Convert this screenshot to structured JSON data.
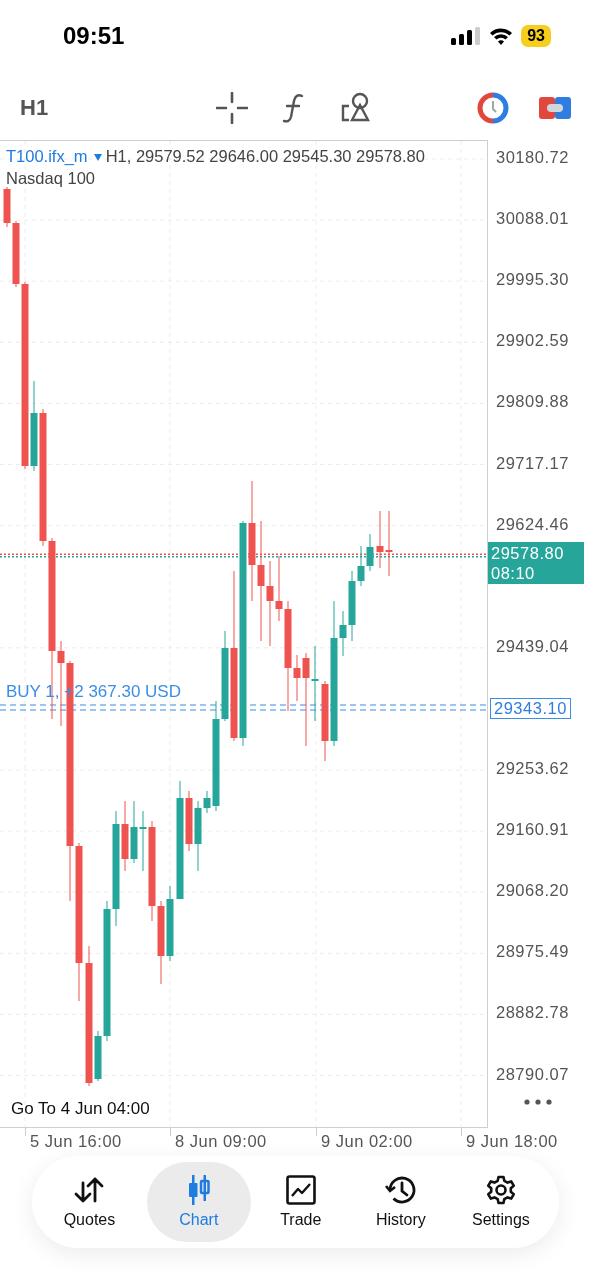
{
  "status_bar": {
    "time": "09:51",
    "battery": "93"
  },
  "toolbar": {
    "timeframe": "H1"
  },
  "chart": {
    "symbol": "T100.ifx_m",
    "info": "H1, 29579.52 29646.00 29545.30 29578.80",
    "description": "Nasdaq 100",
    "price_ticks": [
      "30180.72",
      "30088.01",
      "29995.30",
      "29902.59",
      "29809.88",
      "29717.17",
      "29624.46",
      "29439.04",
      "29253.62",
      "29160.91",
      "29068.20",
      "28975.49",
      "28882.78",
      "28790.07"
    ],
    "current_price": "29578.80",
    "countdown": "08:10",
    "position": {
      "label": "BUY 1, +2 367.30 USD",
      "price": "29343.10"
    },
    "goto": "Go To 4 Jun 04:00",
    "time_ticks": [
      "5 Jun 16:00",
      "8 Jun 09:00",
      "9 Jun 02:00",
      "9 Jun 18:00"
    ]
  },
  "nav": [
    {
      "label": "Quotes",
      "selected": false
    },
    {
      "label": "Chart",
      "selected": true
    },
    {
      "label": "Trade",
      "selected": false
    },
    {
      "label": "History",
      "selected": false
    },
    {
      "label": "Settings",
      "selected": false
    }
  ]
}
